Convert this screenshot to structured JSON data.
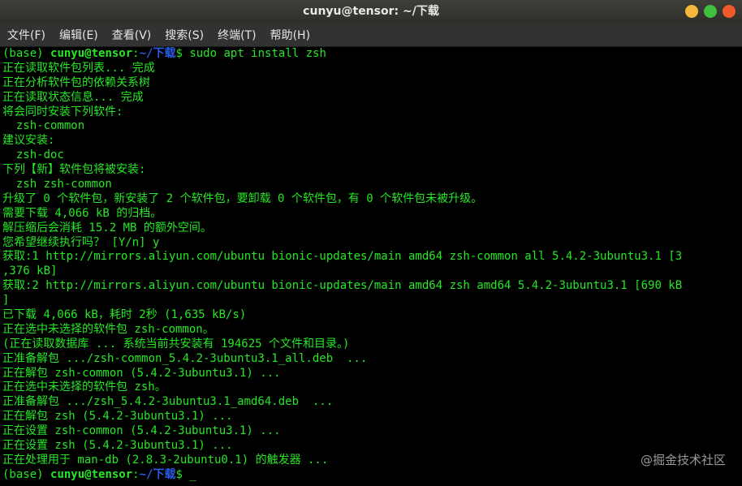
{
  "window": {
    "title": "cunyu@tensor: ~/下载"
  },
  "menu": [
    "文件(F)",
    "编辑(E)",
    "查看(V)",
    "搜索(S)",
    "终端(T)",
    "帮助(H)"
  ],
  "prompt": {
    "env": "(base) ",
    "userhost": "cunyu@tensor",
    "sep": ":",
    "path": "~/下载",
    "sym": "$ "
  },
  "command": "sudo apt install zsh",
  "output": [
    "正在读取软件包列表... 完成",
    "正在分析软件包的依赖关系树",
    "正在读取状态信息... 完成",
    "将会同时安装下列软件:",
    "  zsh-common",
    "建议安装:",
    "  zsh-doc",
    "下列【新】软件包将被安装:",
    "  zsh zsh-common",
    "升级了 0 个软件包，新安装了 2 个软件包，要卸载 0 个软件包，有 0 个软件包未被升级。",
    "需要下载 4,066 kB 的归档。",
    "解压缩后会消耗 15.2 MB 的额外空间。",
    "您希望继续执行吗？ [Y/n] y",
    "获取:1 http://mirrors.aliyun.com/ubuntu bionic-updates/main amd64 zsh-common all 5.4.2-3ubuntu3.1 [3",
    ",376 kB]",
    "获取:2 http://mirrors.aliyun.com/ubuntu bionic-updates/main amd64 zsh amd64 5.4.2-3ubuntu3.1 [690 kB",
    "]",
    "已下载 4,066 kB，耗时 2秒 (1,635 kB/s)",
    "正在选中未选择的软件包 zsh-common。",
    "(正在读取数据库 ... 系统当前共安装有 194625 个文件和目录。)",
    "正准备解包 .../zsh-common_5.4.2-3ubuntu3.1_all.deb  ...",
    "正在解包 zsh-common (5.4.2-3ubuntu3.1) ...",
    "正在选中未选择的软件包 zsh。",
    "正准备解包 .../zsh_5.4.2-3ubuntu3.1_amd64.deb  ...",
    "正在解包 zsh (5.4.2-3ubuntu3.1) ...",
    "正在设置 zsh-common (5.4.2-3ubuntu3.1) ...",
    "正在设置 zsh (5.4.2-3ubuntu3.1) ...",
    "正在处理用于 man-db (2.8.3-2ubuntu0.1) 的触发器 ..."
  ],
  "final_input": "_",
  "watermark": "@掘金技术社区",
  "colors": {
    "text": "#26e626",
    "path": "#2a5ce6",
    "bg": "#000000"
  }
}
